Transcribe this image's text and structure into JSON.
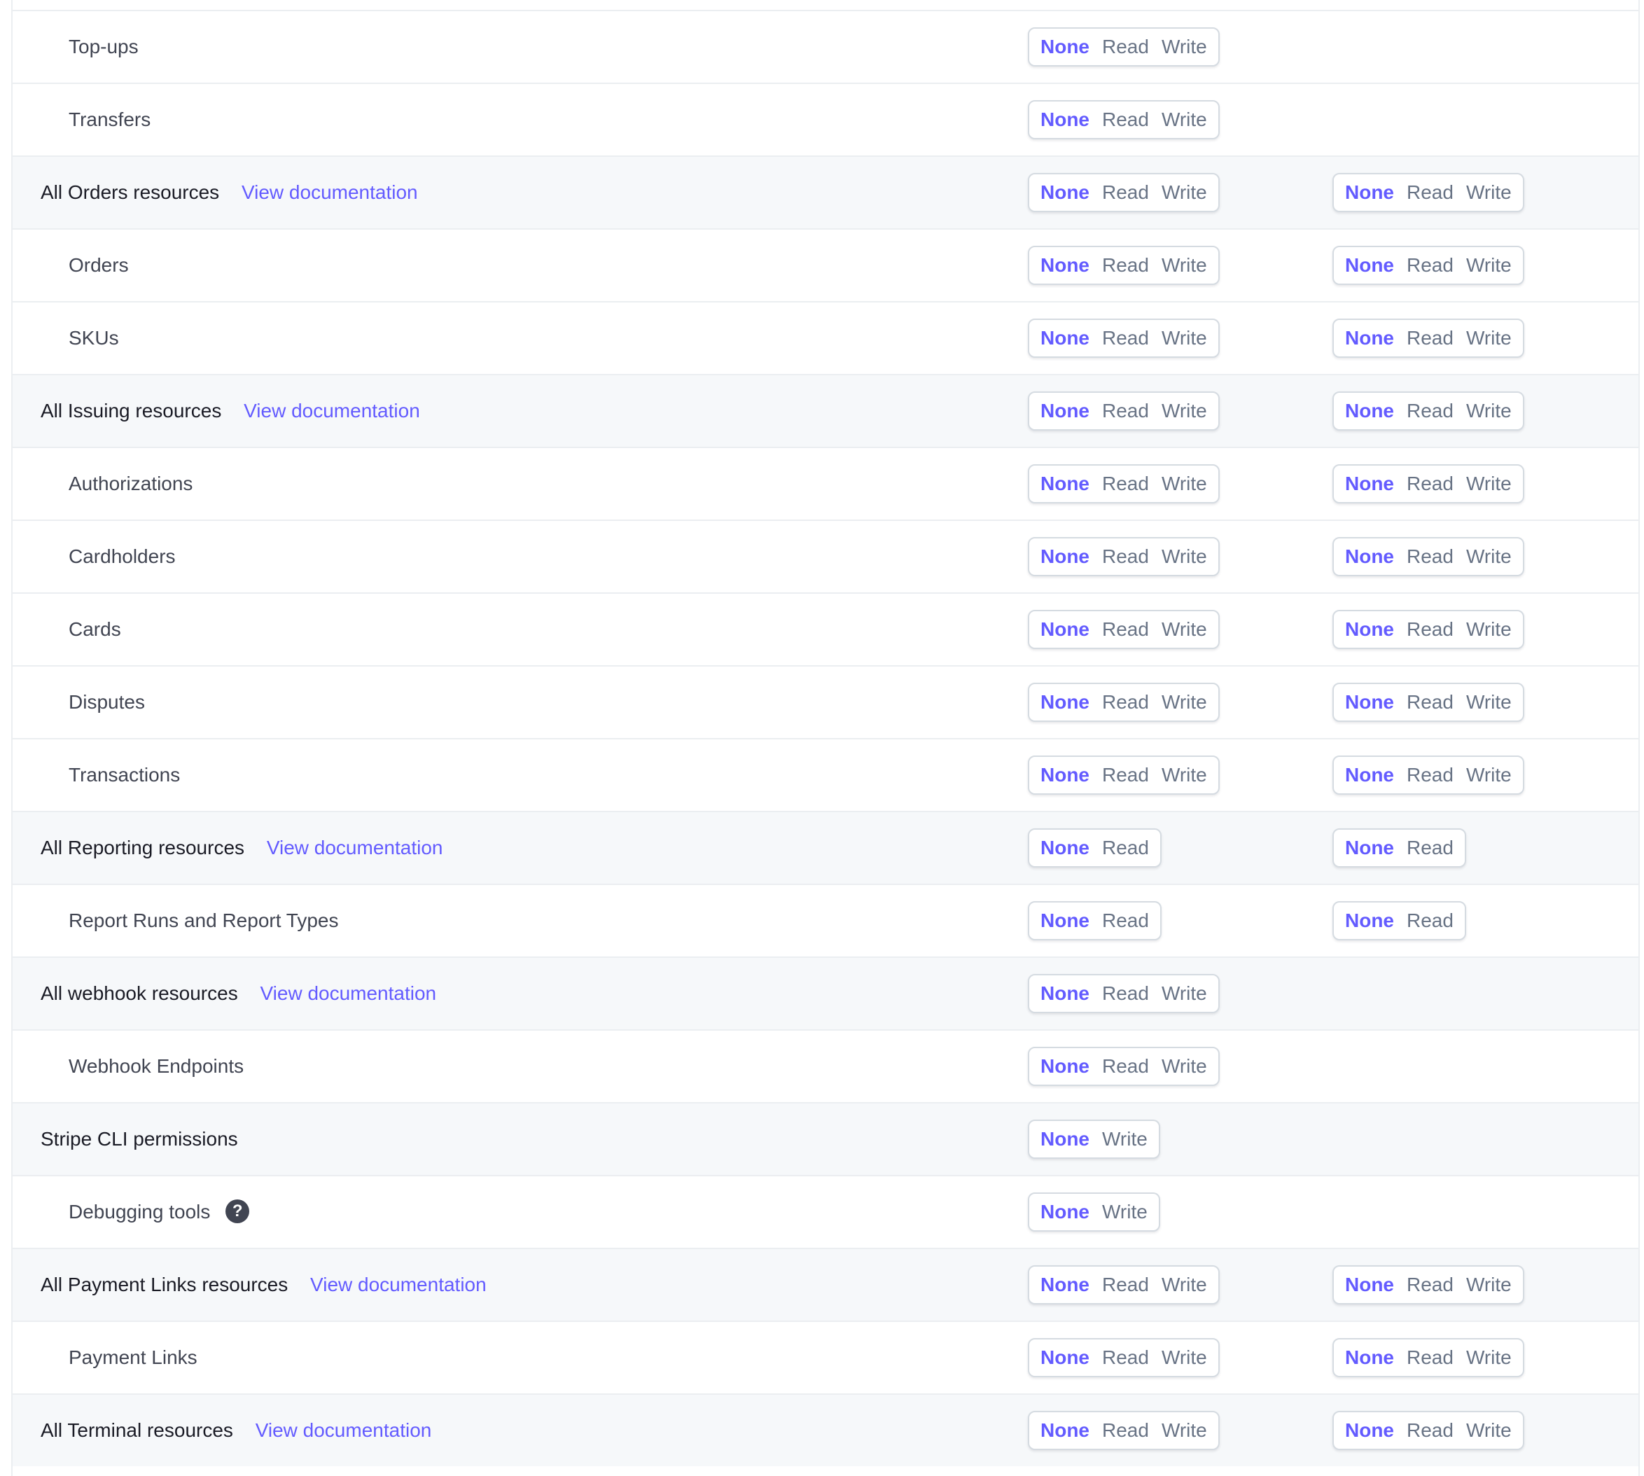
{
  "rows": [
    {
      "type": "child",
      "label": "Top-ups",
      "col1": [
        "None",
        "Read",
        "Write"
      ],
      "col2": null
    },
    {
      "type": "child",
      "label": "Transfers",
      "col1": [
        "None",
        "Read",
        "Write"
      ],
      "col2": null
    },
    {
      "type": "group",
      "label": "All Orders resources",
      "link": "View documentation",
      "col1": [
        "None",
        "Read",
        "Write"
      ],
      "col2": [
        "None",
        "Read",
        "Write"
      ]
    },
    {
      "type": "child",
      "label": "Orders",
      "col1": [
        "None",
        "Read",
        "Write"
      ],
      "col2": [
        "None",
        "Read",
        "Write"
      ]
    },
    {
      "type": "child",
      "label": "SKUs",
      "col1": [
        "None",
        "Read",
        "Write"
      ],
      "col2": [
        "None",
        "Read",
        "Write"
      ]
    },
    {
      "type": "group",
      "label": "All Issuing resources",
      "link": "View documentation",
      "col1": [
        "None",
        "Read",
        "Write"
      ],
      "col2": [
        "None",
        "Read",
        "Write"
      ]
    },
    {
      "type": "child",
      "label": "Authorizations",
      "col1": [
        "None",
        "Read",
        "Write"
      ],
      "col2": [
        "None",
        "Read",
        "Write"
      ]
    },
    {
      "type": "child",
      "label": "Cardholders",
      "col1": [
        "None",
        "Read",
        "Write"
      ],
      "col2": [
        "None",
        "Read",
        "Write"
      ]
    },
    {
      "type": "child",
      "label": "Cards",
      "col1": [
        "None",
        "Read",
        "Write"
      ],
      "col2": [
        "None",
        "Read",
        "Write"
      ]
    },
    {
      "type": "child",
      "label": "Disputes",
      "col1": [
        "None",
        "Read",
        "Write"
      ],
      "col2": [
        "None",
        "Read",
        "Write"
      ]
    },
    {
      "type": "child",
      "label": "Transactions",
      "col1": [
        "None",
        "Read",
        "Write"
      ],
      "col2": [
        "None",
        "Read",
        "Write"
      ]
    },
    {
      "type": "group",
      "label": "All Reporting resources",
      "link": "View documentation",
      "col1": [
        "None",
        "Read"
      ],
      "col2": [
        "None",
        "Read"
      ]
    },
    {
      "type": "child",
      "label": "Report Runs and Report Types",
      "col1": [
        "None",
        "Read"
      ],
      "col2": [
        "None",
        "Read"
      ]
    },
    {
      "type": "group",
      "label": "All webhook resources",
      "link": "View documentation",
      "col1": [
        "None",
        "Read",
        "Write"
      ],
      "col2": null
    },
    {
      "type": "child",
      "label": "Webhook Endpoints",
      "col1": [
        "None",
        "Read",
        "Write"
      ],
      "col2": null
    },
    {
      "type": "group",
      "label": "Stripe CLI permissions",
      "col1": [
        "None",
        "Write"
      ],
      "col2": null
    },
    {
      "type": "child",
      "label": "Debugging tools",
      "help": "?",
      "col1": [
        "None",
        "Write"
      ],
      "col2": null
    },
    {
      "type": "group",
      "label": "All Payment Links resources",
      "link": "View documentation",
      "col1": [
        "None",
        "Read",
        "Write"
      ],
      "col2": [
        "None",
        "Read",
        "Write"
      ]
    },
    {
      "type": "child",
      "label": "Payment Links",
      "col1": [
        "None",
        "Read",
        "Write"
      ],
      "col2": [
        "None",
        "Read",
        "Write"
      ]
    },
    {
      "type": "group",
      "label": "All Terminal resources",
      "link": "View documentation",
      "col1": [
        "None",
        "Read",
        "Write"
      ],
      "col2": [
        "None",
        "Read",
        "Write"
      ]
    }
  ],
  "selected_option": "None",
  "colors": {
    "accent": "#635bff",
    "option_text": "#687385",
    "group_background": "#f6f8fa",
    "border": "#ebeef1"
  },
  "icons": {
    "help": "question-circle-icon"
  }
}
